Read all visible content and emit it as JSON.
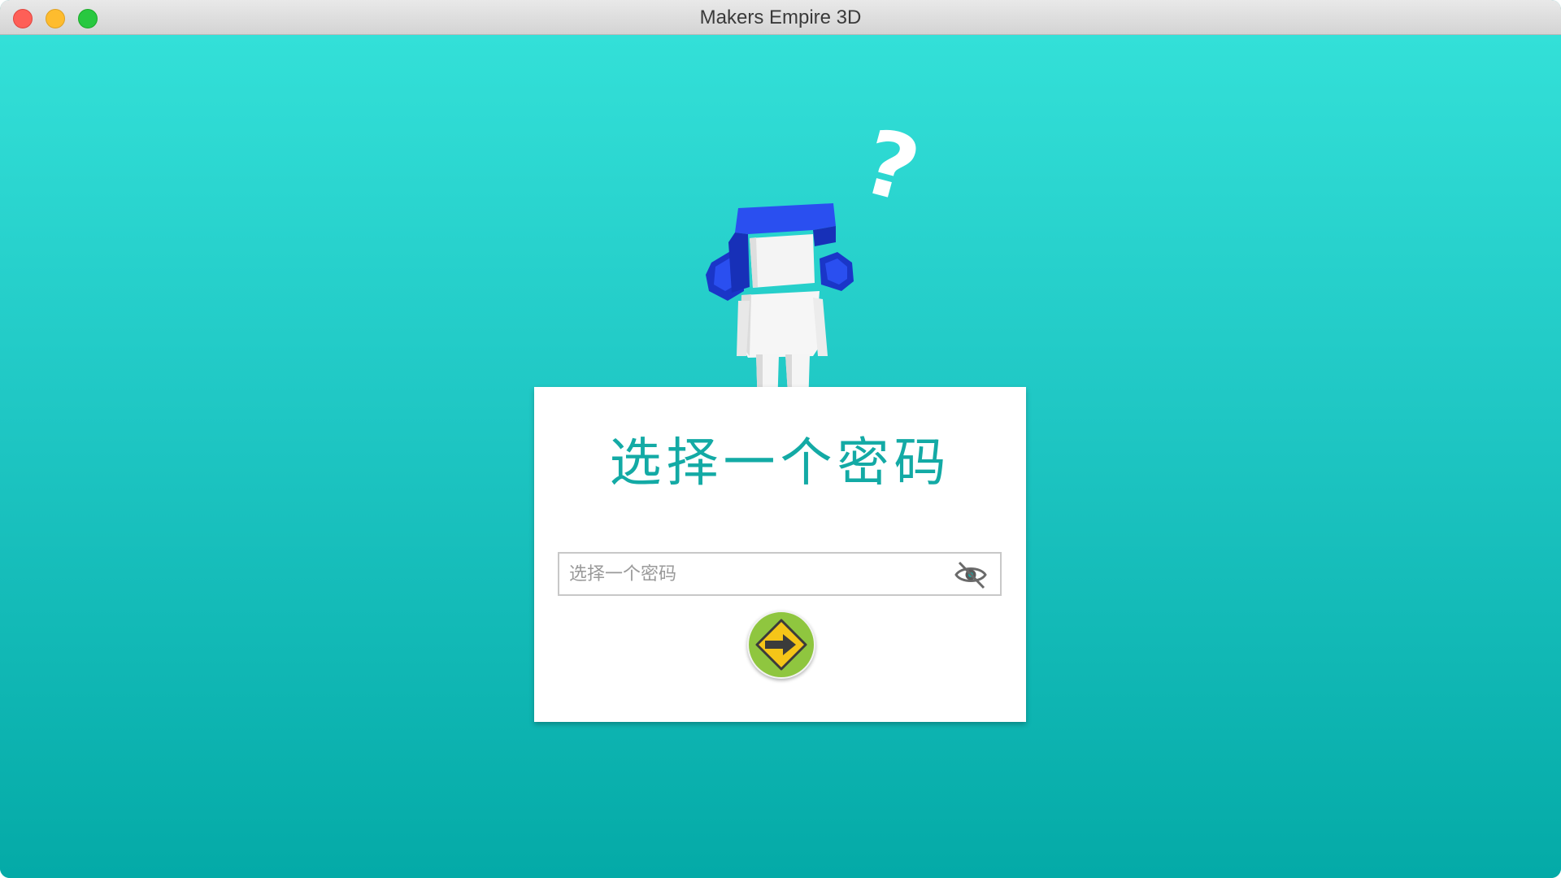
{
  "window": {
    "title": "Makers Empire 3D"
  },
  "colors": {
    "accent": "#13aaa5",
    "background_top": "#33e0d8",
    "background_bottom": "#04aaa7",
    "next_button": "#8fc63f",
    "next_arrow_sign": "#f5c518",
    "avatar_hair": "#1f3fd6"
  },
  "card": {
    "heading": "选择一个密码",
    "password_field": {
      "value": "",
      "placeholder": "选择一个密码"
    },
    "visibility_toggle_icon": "eye-slash-icon",
    "next_button_icon": "arrow-right-sign-icon"
  },
  "mascot": {
    "icon": "confused-avatar-illustration",
    "question_mark": "?"
  }
}
